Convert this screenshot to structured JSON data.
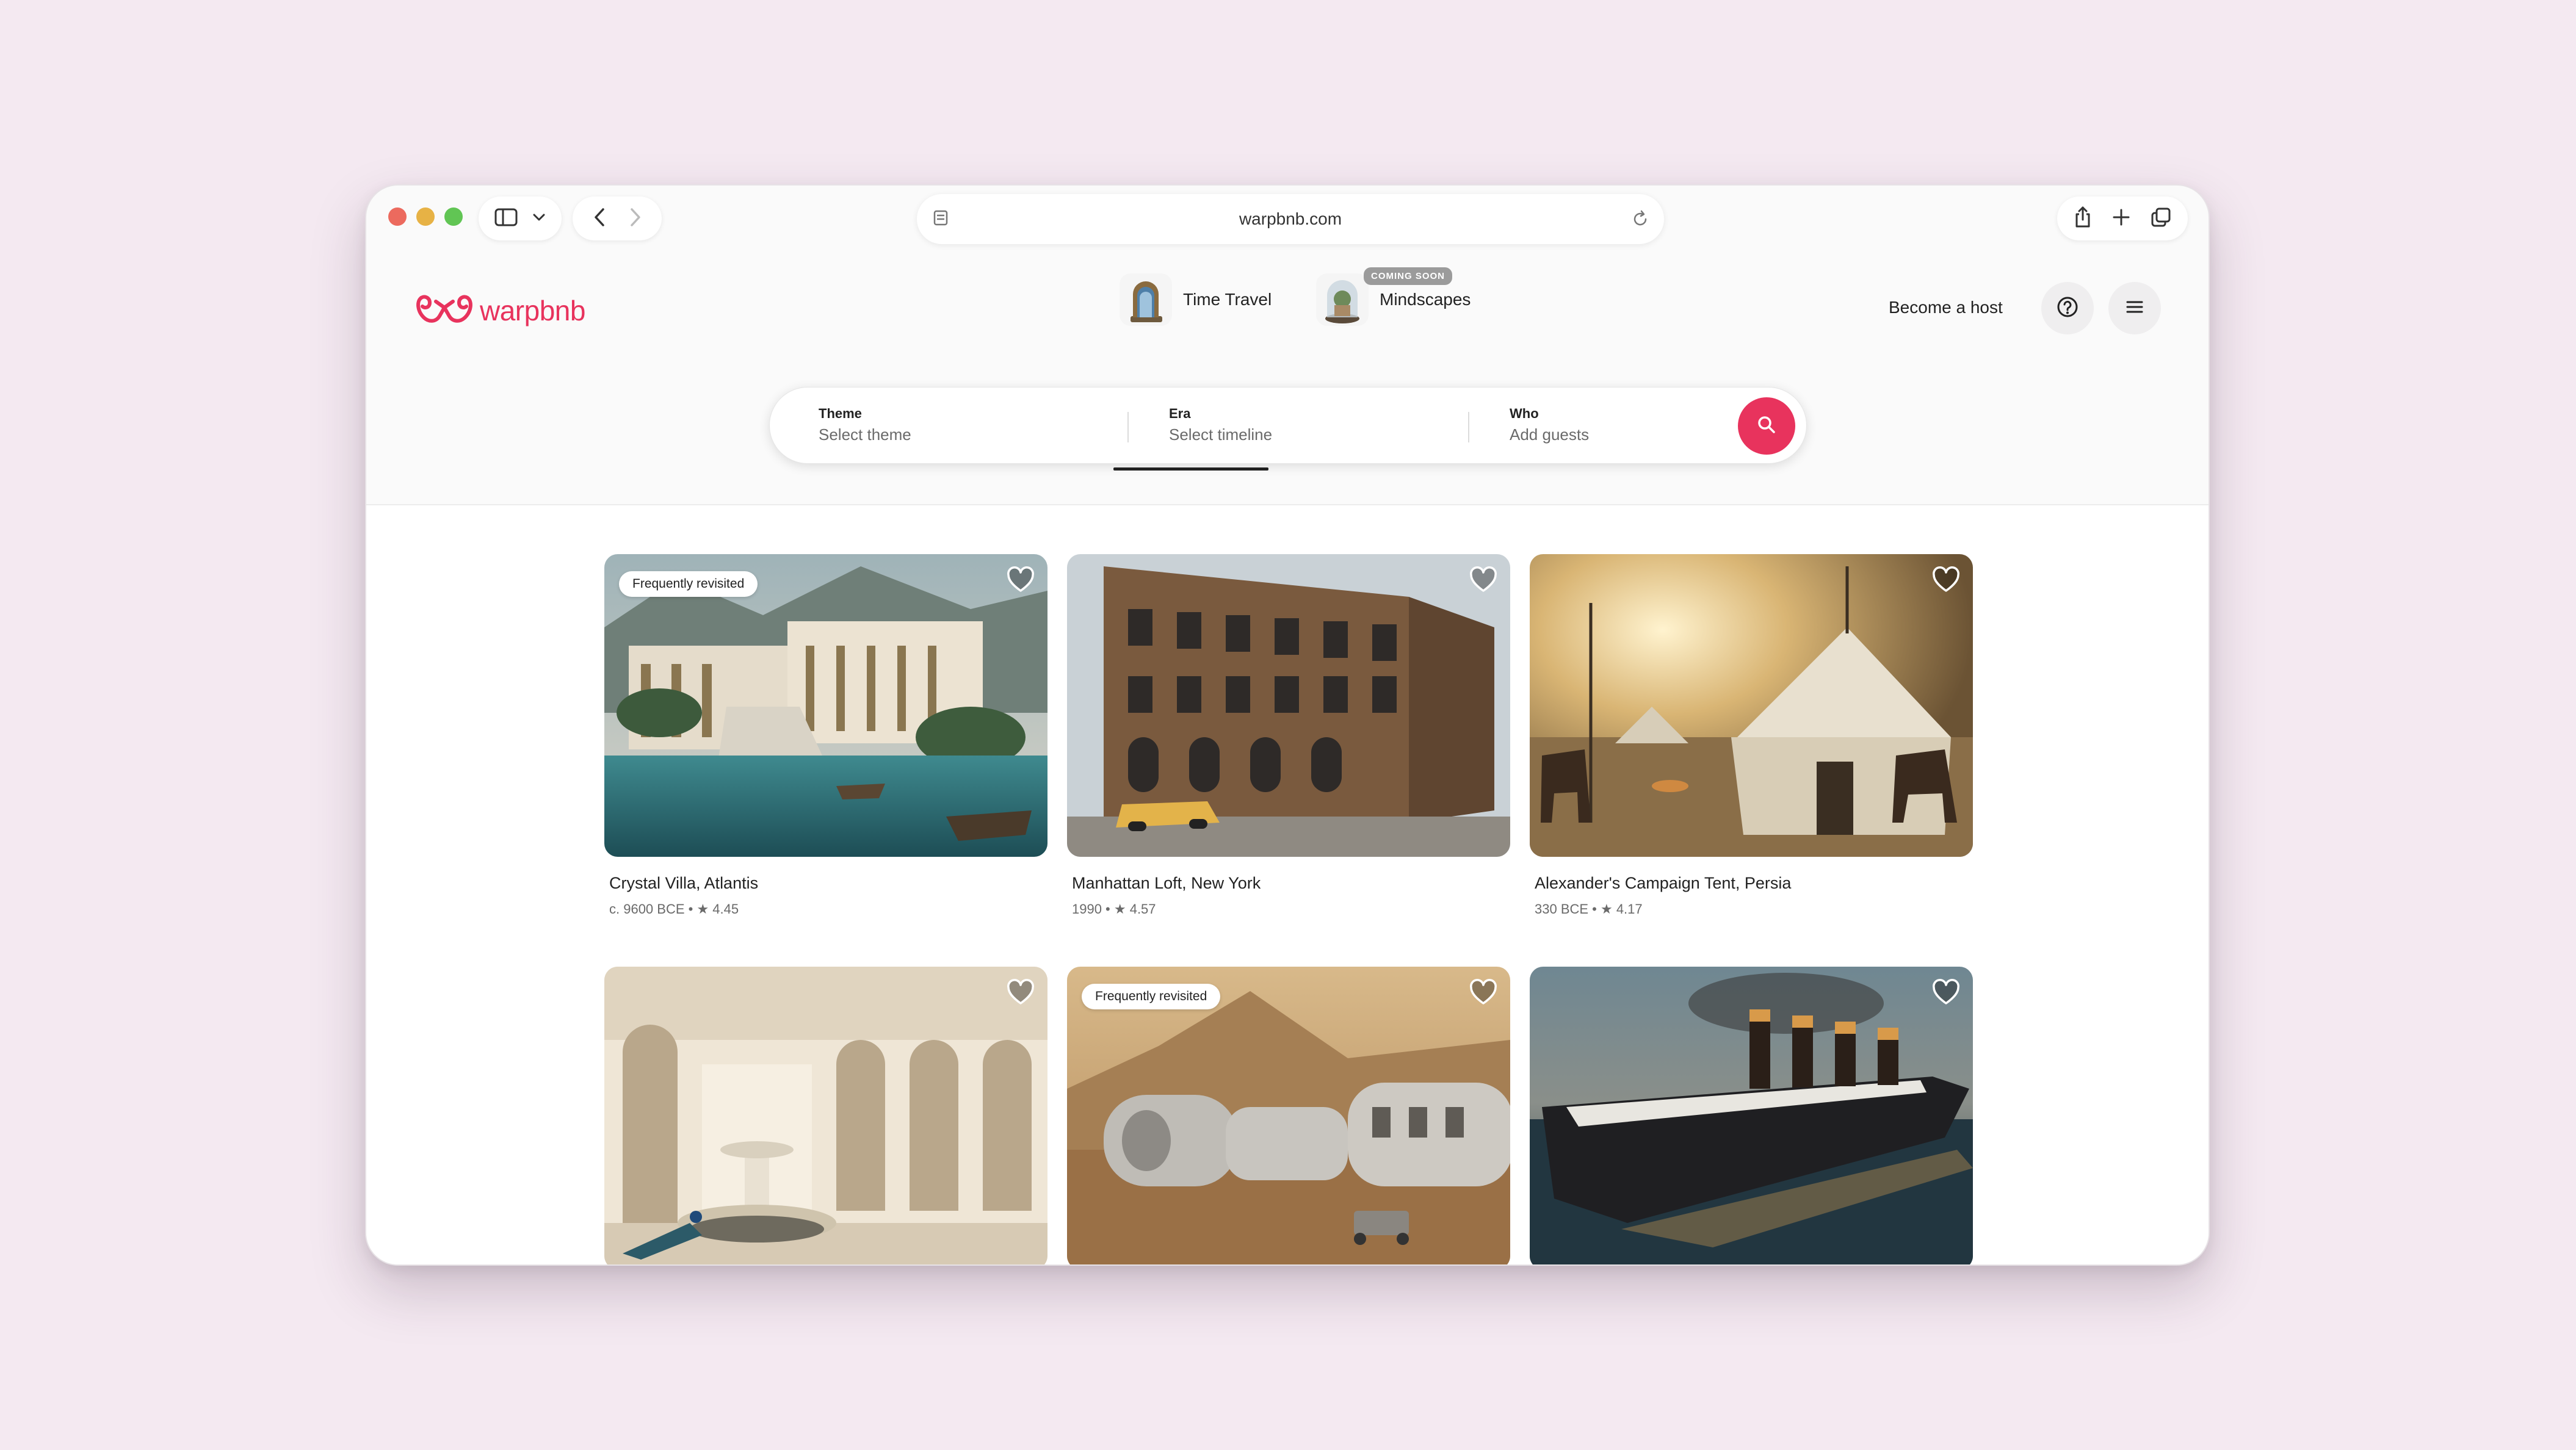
{
  "browser": {
    "url": "warpbnb.com"
  },
  "site": {
    "brand": "warpbnb",
    "brand_color": "#e8335d",
    "categories": [
      {
        "label": "Time Travel",
        "selected": true
      },
      {
        "label": "Mindscapes",
        "badge": "COMING SOON",
        "selected": false
      }
    ],
    "become_host": "Become a host"
  },
  "search": {
    "theme": {
      "label": "Theme",
      "value": "Select theme"
    },
    "era": {
      "label": "Era",
      "value": "Select timeline"
    },
    "who": {
      "label": "Who",
      "value": "Add guests"
    }
  },
  "listings": [
    {
      "title": "Crystal Villa, Atlantis",
      "meta": "c. 9600 BCE • ★ 4.45",
      "badge": "Frequently revisited"
    },
    {
      "title": "Manhattan Loft, New York",
      "meta": "1990 • ★ 4.57",
      "badge": ""
    },
    {
      "title": "Alexander's Campaign Tent, Persia",
      "meta": "330 BCE • ★ 4.17",
      "badge": ""
    },
    {
      "title": "",
      "meta": "",
      "badge": ""
    },
    {
      "title": "",
      "meta": "",
      "badge": "Frequently revisited"
    },
    {
      "title": "",
      "meta": "",
      "badge": ""
    }
  ]
}
